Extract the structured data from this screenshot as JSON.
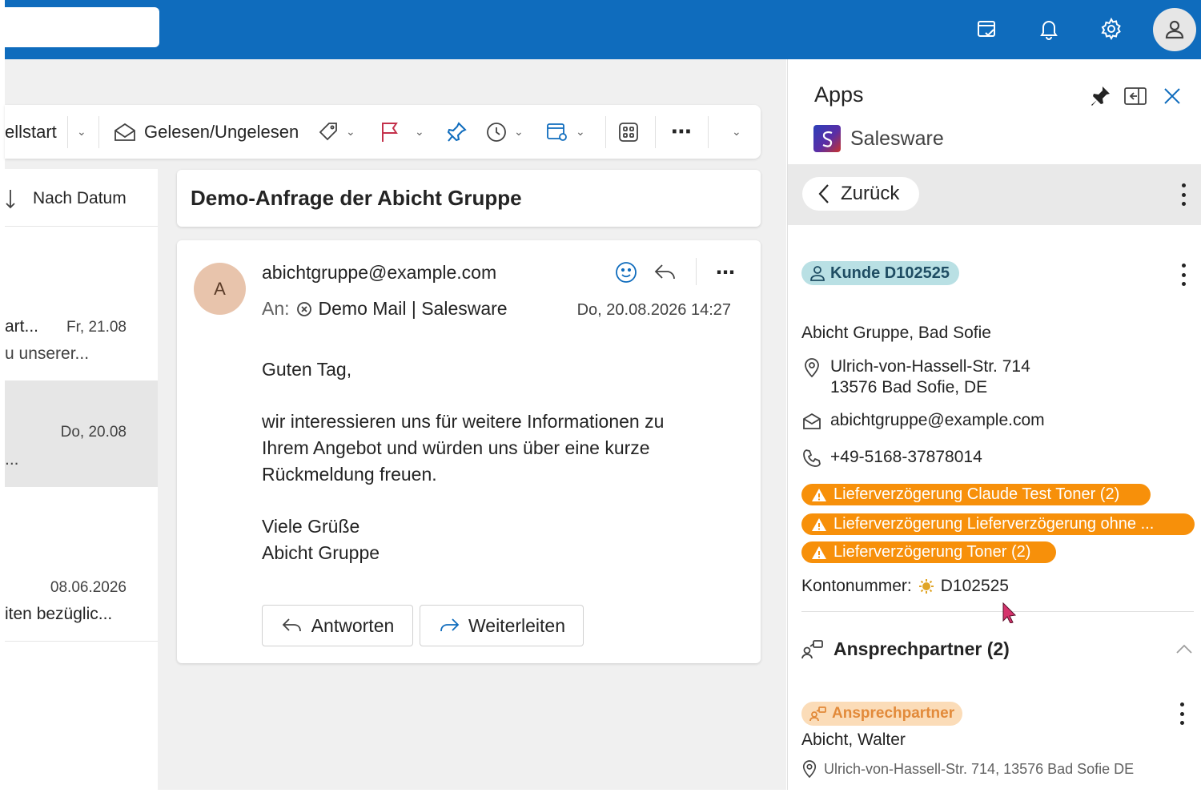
{
  "topbar": {
    "icons": [
      "task-icon",
      "bell-icon",
      "gear-icon",
      "user-avatar-icon"
    ]
  },
  "toolbar": {
    "partial_label": "ellstart",
    "read_unread_label": "Gelesen/Ungelesen"
  },
  "mail_list": {
    "sort_label": "Nach Datum",
    "items": [
      {
        "line1": "art...",
        "date": "Fr, 21.08",
        "line2": "u unserer..."
      },
      {
        "line1": "",
        "date": "Do, 20.08",
        "line2": "..."
      },
      {
        "line1": "",
        "date": "08.06.2026",
        "line2": "iten bezüglic..."
      }
    ]
  },
  "message": {
    "subject": "Demo-Anfrage der Abicht Gruppe",
    "avatar_initial": "A",
    "sender": "abichtgruppe@example.com",
    "to_label": "An:",
    "to_value": "Demo Mail | Salesware",
    "date": "Do, 20.08.2026 14:27",
    "body": [
      "Guten Tag,",
      "wir interessieren uns für weitere Informationen zu",
      "Ihrem Angebot und würden uns über eine kurze",
      "Rückmeldung freuen.",
      "Viele Grüße",
      "Abicht Gruppe"
    ],
    "reply_label": "Antworten",
    "forward_label": "Weiterleiten"
  },
  "apps_pane": {
    "title": "Apps",
    "app_name": "Salesware",
    "back_label": "Zurück",
    "customer_badge": "Kunde D102525",
    "company": "Abicht Gruppe, Bad Sofie",
    "address_line1": "Ulrich-von-Hassell-Str. 714",
    "address_line2": "13576 Bad Sofie, DE",
    "email": "abichtgruppe@example.com",
    "phone": "+49-5168-37878014",
    "warnings": [
      "Lieferverzögerung Claude Test Toner (2)",
      "Lieferverzögerung Lieferverzögerung ohne ...",
      "Lieferverzögerung Toner (2)"
    ],
    "account_label": "Kontonummer:",
    "account_value": "D102525",
    "contacts_title": "Ansprechpartner (2)",
    "contact_badge": "Ansprechpartner",
    "contact_name": "Abicht, Walter",
    "contact_address": "Ulrich-von-Hassell-Str. 714, 13576 Bad Sofie DE"
  },
  "colors": {
    "brand_blue": "#0f6cbd",
    "warning_orange": "#f7900a",
    "customer_badge": "#b9e0e4",
    "contact_badge": "#fbdcb8",
    "flag_red": "#c4314b"
  }
}
